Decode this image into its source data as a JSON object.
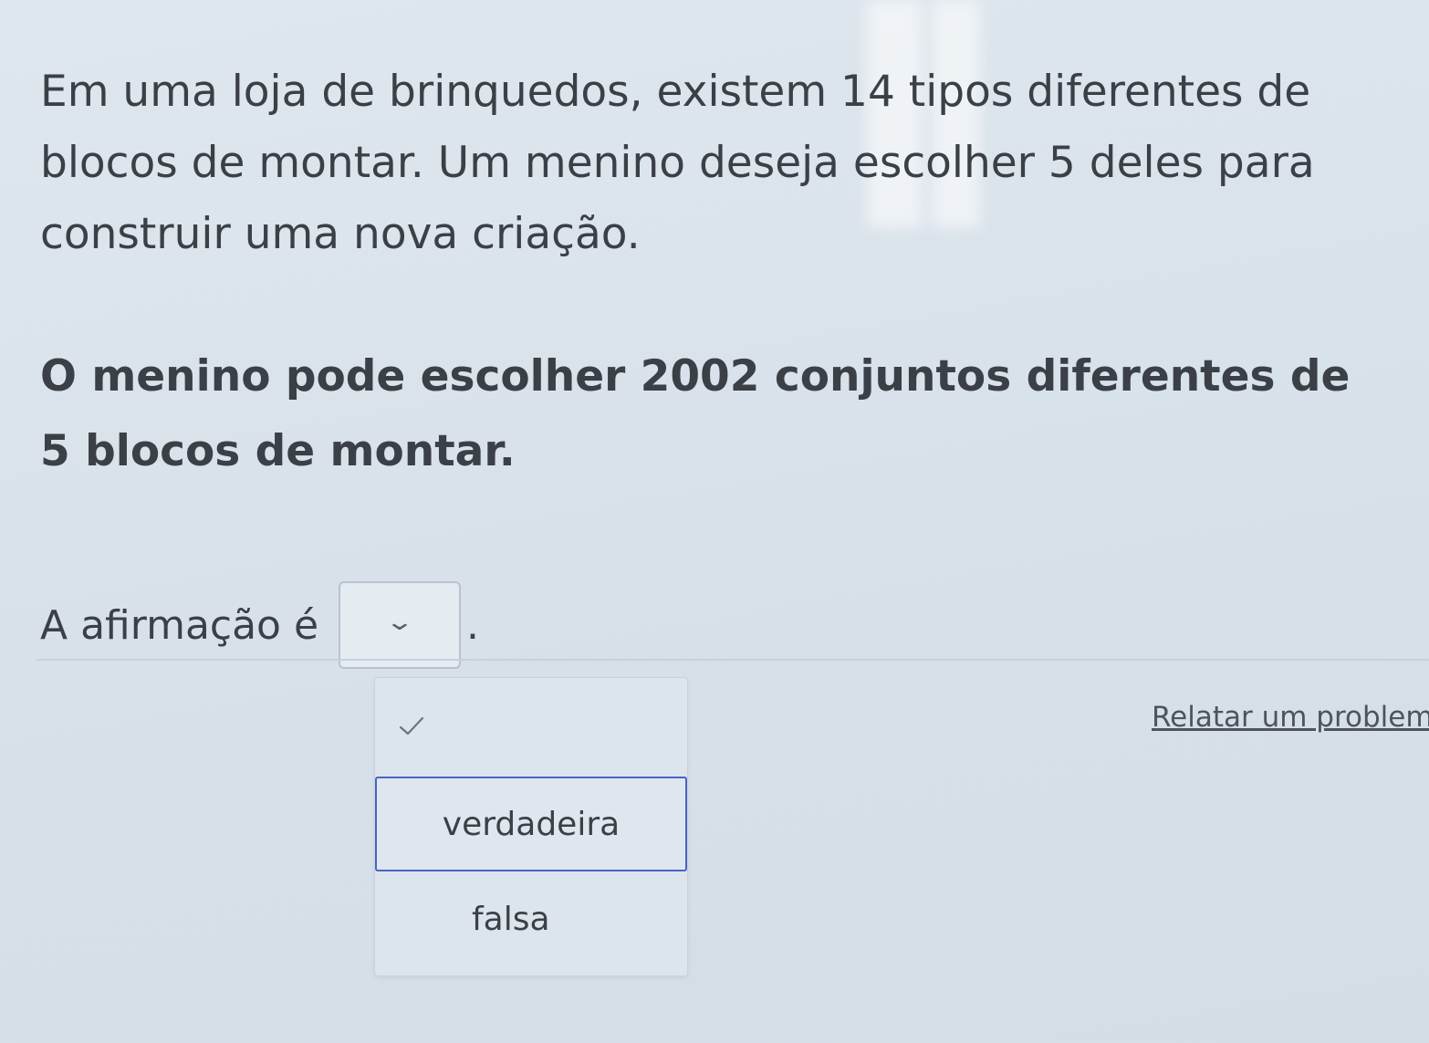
{
  "question": {
    "problem_text": "Em uma loja de brinquedos, existem 14 tipos diferentes de blocos de montar. Um menino deseja escolher 5 deles para construir uma nova criação.",
    "statement_text": "O menino pode escolher 2002 conjuntos diferentes de 5 blocos de montar.",
    "answer_label": "A afirmação é",
    "answer_suffix": "."
  },
  "dropdown": {
    "selected_value": "",
    "chevron_icon": "chevron-down-icon",
    "check_icon": "check-icon",
    "options": [
      {
        "label": "verdadeira",
        "highlighted": true
      },
      {
        "label": "falsa",
        "highlighted": false
      }
    ]
  },
  "footer": {
    "report_link": "Relatar um problem"
  },
  "colors": {
    "highlight_border": "#4664c8",
    "text": "#3b4047",
    "background": "#d9e2ea"
  }
}
